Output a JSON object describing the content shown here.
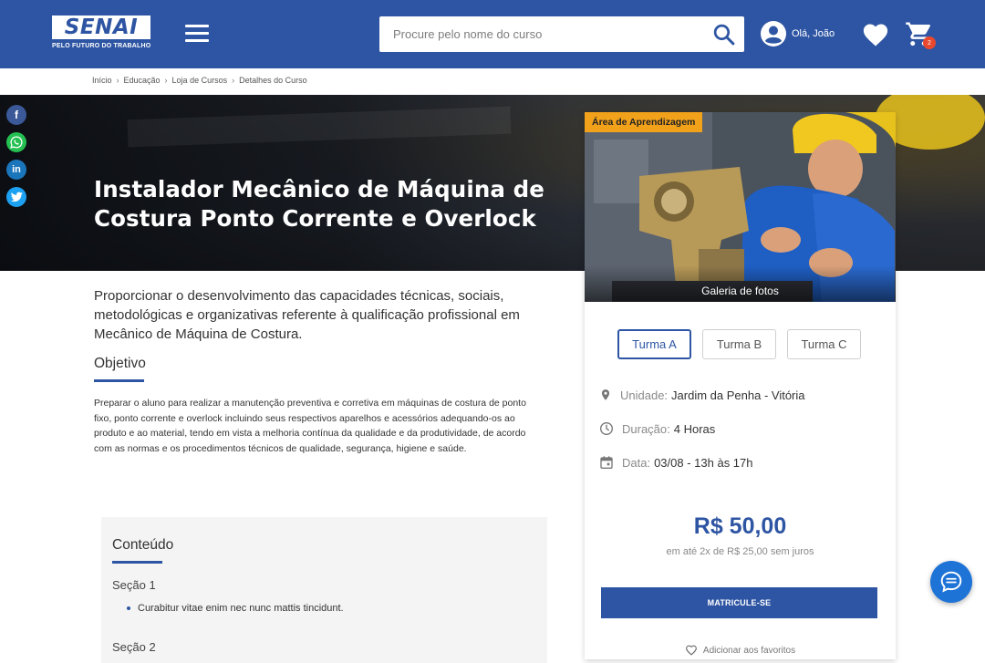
{
  "header": {
    "logo_text": "SENAI",
    "logo_tagline": "PELO FUTURO DO TRABALHO",
    "search_placeholder": "Procure pelo nome do curso",
    "user_greeting": "Olá, João",
    "cart_count": "2"
  },
  "breadcrumb": [
    "Início",
    "Educação",
    "Loja de Cursos",
    "Detalhes do Curso"
  ],
  "hero": {
    "title": "Instalador Mecânico de Máquina de Costura Ponto Corrente e Overlock"
  },
  "social": [
    "facebook-icon",
    "whatsapp-icon",
    "linkedin-icon",
    "twitter-icon"
  ],
  "card": {
    "tag": "Área de Aprendizagem",
    "gallery_label": "Galeria de fotos",
    "turmas": [
      "Turma A",
      "Turma B",
      "Turma C"
    ],
    "active_turma": "Turma A",
    "unit_label": "Unidade:",
    "unit_value": "Jardim da Penha - Vitória",
    "duration_label": "Duração:",
    "duration_value": "4 Horas",
    "date_label": "Data:",
    "date_value": "03/08 - 13h às 17h",
    "price": "R$ 50,00",
    "installments": "em até 2x de R$ 25,00 sem juros",
    "enroll_label": "MATRICULE-SE",
    "favorite_label": "Adicionar aos favoritos"
  },
  "main": {
    "intro": "Proporcionar o desenvolvimento das capacidades técnicas, sociais, metodológicas e organizativas referente à qualificação profissional em Mecânico de Máquina de Costura.",
    "objective_title": "Objetivo",
    "objective_text": "Preparar o aluno para realizar a manutenção preventiva e corretiva em máquinas de costura de ponto fixo, ponto corrente e overlock incluindo seus respectivos aparelhos e acessórios adequando-os ao produto e ao material, tendo em vista a melhoria contínua da qualidade e da produtividade, de acordo com as normas e os procedimentos técnicos de qualidade, segurança, higiene e saúde.",
    "contents_title": "Conteúdo",
    "section1": "Seção 1",
    "section1_item": "Curabitur vitae enim nec nunc mattis tincidunt.",
    "section2": "Seção 2"
  },
  "colors": {
    "brand_blue": "#2e55a3",
    "tag_orange": "#f2a11b",
    "chat_blue": "#1e73d6"
  }
}
